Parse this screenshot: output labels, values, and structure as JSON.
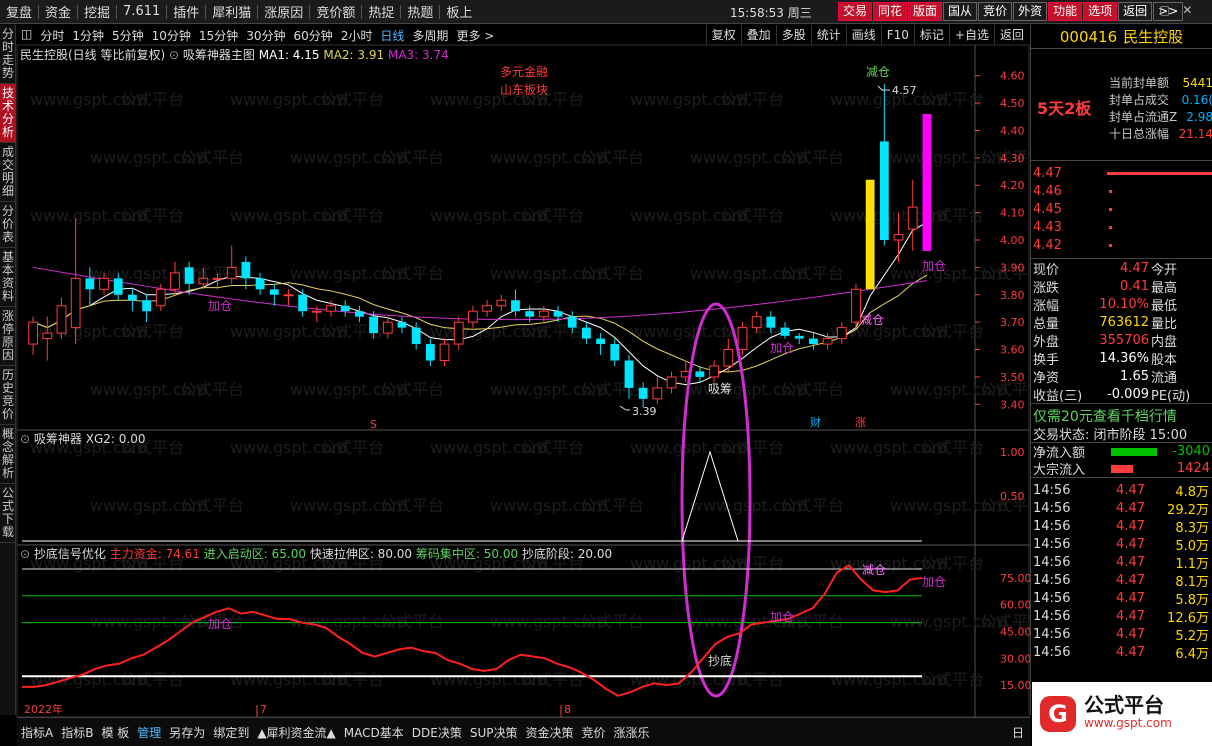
{
  "menubar": {
    "items": [
      "复盘",
      "资金",
      "挖掘",
      "7.611",
      "插件",
      "犀利猫",
      "涨原因",
      "竞价额",
      "热捉",
      "热题",
      "板上"
    ],
    "clock": "15:58:53 周三",
    "buttons": [
      "交易",
      "同花",
      "版面",
      "国从",
      "竞价",
      "外资",
      "功能",
      "选项",
      "返回",
      ">>"
    ],
    "winctl": [
      "—",
      "▢",
      "✕"
    ]
  },
  "sidebar": {
    "tabs": [
      "分时走势",
      "技术分析",
      "成交明细",
      "分价表",
      "基本资料",
      "涨停原因",
      "历史竞价",
      "概念解析",
      "公式下载"
    ],
    "active": 1
  },
  "toolbar": {
    "items": [
      "分时",
      "1分钟",
      "5分钟",
      "10分钟",
      "15分钟",
      "30分钟",
      "60分钟",
      "2小时",
      "日线",
      "多周期",
      "更多 >"
    ],
    "active": 8,
    "right": [
      "复权",
      "叠加",
      "多股",
      "统计",
      "画线",
      "F10",
      "标记",
      "+自选",
      "返回"
    ]
  },
  "main": {
    "title": "民生控股(日线 等比前复权)",
    "indicator": "吸筹神器主图",
    "ma1": "MA1: 4.15",
    "ma2": "MA2: 3.91",
    "ma3": "MA3: 3.74",
    "note1": "多元金融",
    "note2": "山东板块",
    "label_jiancang": "减仓",
    "label_jiacang": "加仓",
    "label_xichou": "吸筹",
    "label_jiancang2": "减仓",
    "label_high": "4.57",
    "label_low": "3.39",
    "label_s": "S",
    "label_cai": "财",
    "label_zhang": "涨",
    "watermark": "www.gspt.com",
    "wm_text": "公式平台",
    "yaxis": [
      "4.60",
      "4.50",
      "4.40",
      "4.30",
      "4.20",
      "4.10",
      "4.00",
      "3.90",
      "3.80",
      "3.70",
      "3.60",
      "3.50",
      "3.40"
    ]
  },
  "sub1": {
    "title": "吸筹神器",
    "xg2": "XG2: 0.00",
    "yaxis": [
      "1.00",
      "0.50"
    ]
  },
  "sub2": {
    "title": "抄底信号优化",
    "line1": "主力资金: 74.61",
    "line2": "进入启动区: 65.00",
    "line3": "快速拉伸区: 80.00",
    "line4": "筹码集中区: 50.00",
    "line5": "抄底阶段: 20.00",
    "label_chaodi": "抄底",
    "label_jiacang": "加仓",
    "label_jiancang": "减仓",
    "yaxis": [
      "75.00",
      "60.00",
      "45.00",
      "30.00",
      "15.00"
    ],
    "xaxis": [
      "2022年",
      "7",
      "8"
    ]
  },
  "stock": {
    "code": "000416",
    "name": "民生控股",
    "limit_up": "5天2板",
    "seal_amount_label": "当前封单额",
    "seal_amount": "5441",
    "seal_deal_label": "封单占成交",
    "seal_deal": "0.16(",
    "seal_float_label": "封单占流通Z",
    "seal_float": "2.98",
    "ten_day_label": "十日总涨幅",
    "ten_day": "21.14"
  },
  "orderbook": {
    "prices": [
      "4.47",
      "4.46",
      "4.45",
      "4.43",
      "4.42"
    ]
  },
  "quote": {
    "rows": [
      [
        "现价",
        "4.47",
        "今开",
        ""
      ],
      [
        "涨跌",
        "0.41",
        "最高",
        ""
      ],
      [
        "涨幅",
        "10.10%",
        "最低",
        ""
      ],
      [
        "总量",
        "763612",
        "量比",
        ""
      ],
      [
        "外盘",
        "355706",
        "内盘",
        ""
      ],
      [
        "换手",
        "14.36%",
        "股本",
        ""
      ],
      [
        "净资",
        "1.65",
        "流通",
        ""
      ],
      [
        "收益(三)",
        "-0.009",
        "PE(动)",
        ""
      ]
    ],
    "promo": "仅需20元查看千档行情",
    "status": "交易状态: 闭市阶段 15:00",
    "netflow_label": "净流入额",
    "netflow": "-3040",
    "block_label": "大宗流入",
    "block": "1424"
  },
  "ticks": [
    [
      "14:56",
      "4.47",
      "4.8万"
    ],
    [
      "14:56",
      "4.47",
      "29.2万"
    ],
    [
      "14:56",
      "4.47",
      "8.3万"
    ],
    [
      "14:56",
      "4.47",
      "5.0万"
    ],
    [
      "14:56",
      "4.47",
      "1.1万"
    ],
    [
      "14:56",
      "4.47",
      "8.1万"
    ],
    [
      "14:56",
      "4.47",
      "5.8万"
    ],
    [
      "14:56",
      "4.47",
      "12.6万"
    ],
    [
      "14:56",
      "4.47",
      "5.2万"
    ],
    [
      "14:56",
      "4.47",
      "6.4万"
    ]
  ],
  "bottom": {
    "items": [
      "指标A",
      "指标B",
      "模 板",
      "管理",
      "另存为",
      "绑定到",
      "▲犀利资金流▲",
      "MACD基本",
      "DDE决策",
      "SUP决策",
      "资金决策",
      "竞价",
      "涨涨乐"
    ],
    "active": 3,
    "right": "日"
  },
  "logo": {
    "name": "公式平台",
    "url": "www.gspt.com",
    "g": "G"
  },
  "colors": {
    "up": "#ff3b3b",
    "down": "#00e5ff",
    "ma1": "#ffffff",
    "ma2": "#e6d35a",
    "ma3": "#d12cd1",
    "purple": "#d12cd1",
    "yellow": "#ffd700",
    "green": "#00c000"
  },
  "chart_data": {
    "type": "candlestick",
    "title": "民生控股(日线 等比前复权)",
    "ylim": [
      3.35,
      4.65
    ],
    "annotations": {
      "high": 4.57,
      "low": 3.39
    },
    "candles": [
      [
        3.62,
        3.7,
        3.58,
        3.72
      ],
      [
        3.64,
        3.66,
        3.56,
        3.72
      ],
      [
        3.66,
        3.76,
        3.64,
        3.79
      ],
      [
        3.68,
        3.86,
        3.62,
        4.08
      ],
      [
        3.86,
        3.82,
        3.76,
        3.9
      ],
      [
        3.82,
        3.86,
        3.8,
        3.88
      ],
      [
        3.86,
        3.8,
        3.78,
        3.88
      ],
      [
        3.8,
        3.78,
        3.74,
        3.82
      ],
      [
        3.78,
        3.74,
        3.7,
        3.8
      ],
      [
        3.76,
        3.82,
        3.74,
        3.84
      ],
      [
        3.82,
        3.88,
        3.8,
        3.92
      ],
      [
        3.9,
        3.84,
        3.8,
        3.92
      ],
      [
        3.84,
        3.86,
        3.82,
        3.9
      ],
      [
        3.86,
        3.86,
        3.82,
        3.88
      ],
      [
        3.86,
        3.9,
        3.84,
        3.98
      ],
      [
        3.92,
        3.86,
        3.82,
        3.94
      ],
      [
        3.86,
        3.82,
        3.8,
        3.88
      ],
      [
        3.82,
        3.8,
        3.76,
        3.84
      ],
      [
        3.8,
        3.8,
        3.76,
        3.82
      ],
      [
        3.8,
        3.74,
        3.72,
        3.82
      ],
      [
        3.74,
        3.74,
        3.7,
        3.76
      ],
      [
        3.74,
        3.76,
        3.72,
        3.78
      ],
      [
        3.76,
        3.74,
        3.72,
        3.78
      ],
      [
        3.74,
        3.72,
        3.7,
        3.76
      ],
      [
        3.72,
        3.66,
        3.64,
        3.74
      ],
      [
        3.66,
        3.7,
        3.64,
        3.72
      ],
      [
        3.7,
        3.68,
        3.66,
        3.72
      ],
      [
        3.68,
        3.62,
        3.6,
        3.7
      ],
      [
        3.62,
        3.56,
        3.54,
        3.64
      ],
      [
        3.56,
        3.62,
        3.54,
        3.64
      ],
      [
        3.62,
        3.7,
        3.6,
        3.72
      ],
      [
        3.7,
        3.74,
        3.68,
        3.76
      ],
      [
        3.74,
        3.76,
        3.72,
        3.78
      ],
      [
        3.76,
        3.78,
        3.74,
        3.8
      ],
      [
        3.78,
        3.74,
        3.72,
        3.82
      ],
      [
        3.74,
        3.72,
        3.7,
        3.76
      ],
      [
        3.72,
        3.74,
        3.7,
        3.76
      ],
      [
        3.74,
        3.72,
        3.7,
        3.76
      ],
      [
        3.72,
        3.68,
        3.66,
        3.74
      ],
      [
        3.68,
        3.64,
        3.62,
        3.7
      ],
      [
        3.64,
        3.62,
        3.58,
        3.66
      ],
      [
        3.62,
        3.56,
        3.54,
        3.64
      ],
      [
        3.56,
        3.46,
        3.42,
        3.58
      ],
      [
        3.46,
        3.42,
        3.39,
        3.48
      ],
      [
        3.42,
        3.46,
        3.4,
        3.5
      ],
      [
        3.46,
        3.5,
        3.44,
        3.52
      ],
      [
        3.5,
        3.52,
        3.48,
        3.56
      ],
      [
        3.52,
        3.5,
        3.48,
        3.54
      ],
      [
        3.5,
        3.54,
        3.48,
        3.56
      ],
      [
        3.54,
        3.6,
        3.52,
        3.64
      ],
      [
        3.6,
        3.68,
        3.58,
        3.7
      ],
      [
        3.68,
        3.72,
        3.66,
        3.74
      ],
      [
        3.72,
        3.68,
        3.66,
        3.74
      ],
      [
        3.68,
        3.65,
        3.64,
        3.7
      ],
      [
        3.65,
        3.64,
        3.62,
        3.66
      ],
      [
        3.64,
        3.62,
        3.6,
        3.66
      ],
      [
        3.62,
        3.64,
        3.6,
        3.66
      ],
      [
        3.64,
        3.68,
        3.62,
        3.7
      ],
      [
        3.7,
        3.82,
        3.68,
        3.84
      ],
      [
        3.82,
        4.22,
        3.82,
        4.22
      ],
      [
        4.36,
        4.0,
        3.98,
        4.57
      ],
      [
        4.0,
        4.02,
        3.92,
        4.1
      ],
      [
        4.04,
        4.12,
        3.96,
        4.22
      ],
      [
        4.46,
        3.96,
        3.96,
        4.46
      ]
    ],
    "series": [
      {
        "name": "主力资金",
        "values": [
          14,
          14,
          15,
          17,
          19,
          21,
          24,
          26,
          27,
          30,
          32,
          36,
          40,
          45,
          50,
          53,
          56,
          58,
          55,
          56,
          54,
          52,
          52,
          50,
          49,
          47,
          42,
          38,
          33,
          31,
          33,
          35,
          36,
          34,
          33,
          29,
          27,
          24,
          23,
          24,
          29,
          32,
          31,
          30,
          27,
          25,
          22,
          18,
          13,
          9,
          11,
          14,
          16,
          15,
          16,
          22,
          30,
          38,
          42,
          44,
          49,
          50,
          51,
          52,
          55,
          58,
          66,
          78,
          82,
          74,
          68,
          67,
          68,
          74,
          75
        ]
      },
      {
        "name": "进入启动区",
        "values": [
          65
        ]
      },
      {
        "name": "快速拉伸区",
        "values": [
          80
        ]
      },
      {
        "name": "筹码集中区",
        "values": [
          50
        ]
      },
      {
        "name": "抄底阶段",
        "values": [
          20
        ]
      }
    ]
  }
}
